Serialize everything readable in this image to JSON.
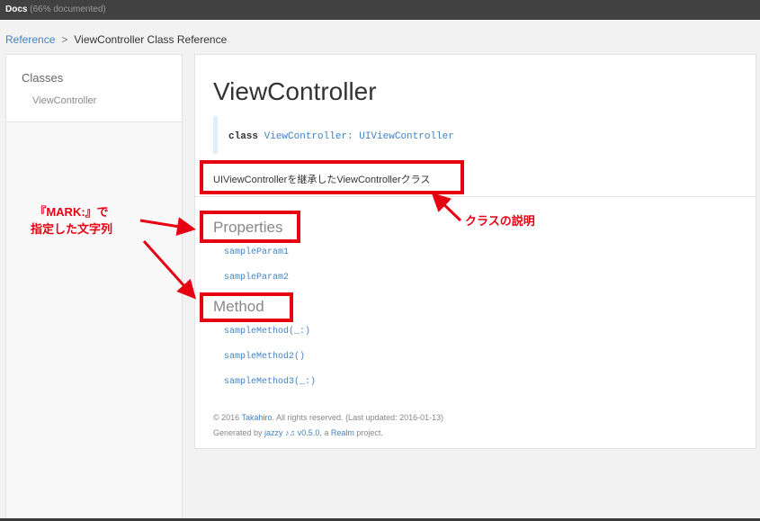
{
  "topbar": {
    "title": "Docs",
    "coverage": "(66% documented)"
  },
  "breadcrumb": {
    "root": "Reference",
    "separator": ">",
    "current": "ViewController Class Reference"
  },
  "sidebar": {
    "heading": "Classes",
    "items": [
      {
        "label": "ViewController"
      }
    ]
  },
  "main": {
    "title": "ViewController",
    "declaration": {
      "keyword": "class",
      "rest": " ViewController: UIViewController"
    },
    "description": "UIViewControllerを継承したViewControllerクラス",
    "sections": [
      {
        "title": "Properties",
        "items": [
          "sampleParam1",
          "sampleParam2"
        ]
      },
      {
        "title": "Method",
        "items": [
          "sampleMethod(_:)",
          "sampleMethod2()",
          "sampleMethod3(_:)"
        ]
      }
    ],
    "footer": {
      "copyright_prefix": "© 2016 ",
      "author": "Takahiro",
      "copyright_suffix": ". All rights reserved. (Last updated: 2016-01-13)",
      "generated_prefix": "Generated by ",
      "tool": "jazzy ♪♫ v0.5.0",
      "generated_mid": ", a ",
      "org": "Realm",
      "generated_suffix": " project."
    }
  },
  "annotations": {
    "mark_label_line1": "『MARK:』で",
    "mark_label_line2": "指定した文字列",
    "description_label": "クラスの説明",
    "color": "#e60012"
  }
}
